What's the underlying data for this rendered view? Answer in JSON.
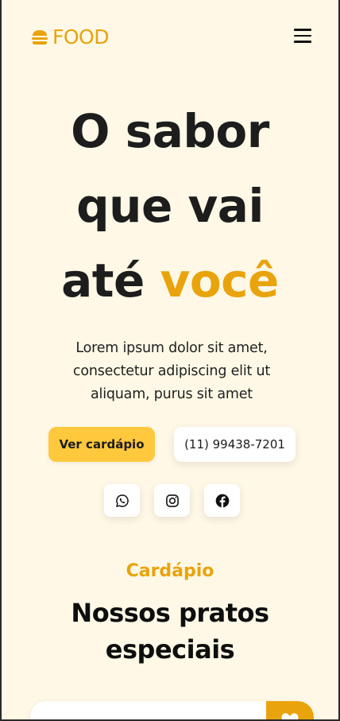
{
  "brand": {
    "logo_text": "FOOD",
    "logo_icon": "burger-icon",
    "accent_color": "#e9a30c",
    "background_color": "#fff8e6"
  },
  "nav": {
    "menu_icon": "hamburger-menu-icon"
  },
  "hero": {
    "title_line1": "O sabor",
    "title_line2": "que vai",
    "title_line3_prefix": "até ",
    "title_line3_accent": "você",
    "description": "Lorem ipsum dolor sit amet, consectetur adipiscing elit ut aliquam, purus sit amet",
    "primary_button": "Ver cardápio",
    "phone_button": "(11) 99438-7201",
    "primary_button_color": "#ffc83d"
  },
  "social": [
    {
      "name": "whatsapp",
      "icon": "whatsapp-icon"
    },
    {
      "name": "instagram",
      "icon": "instagram-icon"
    },
    {
      "name": "facebook",
      "icon": "facebook-icon"
    }
  ],
  "menu_section": {
    "tag": "Cardápio",
    "title_line1": "Nossos pratos",
    "title_line2": "especiais",
    "card_fav_icon": "heart-icon"
  }
}
